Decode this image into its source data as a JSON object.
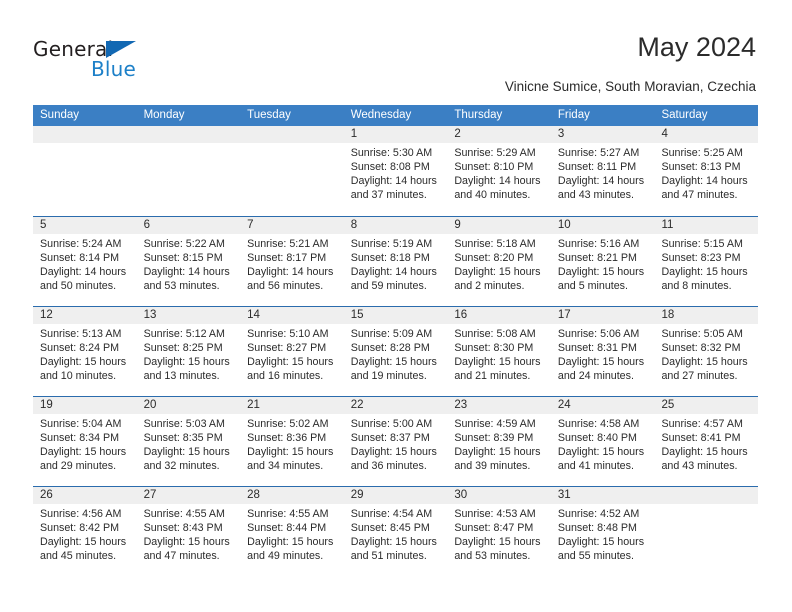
{
  "brand": {
    "name_part1": "General",
    "name_part2": "Blue",
    "triangle_color": "#1268b3",
    "blue_color": "#1d80c8"
  },
  "header": {
    "title": "May 2024",
    "subtitle": "Vinicne Sumice, South Moravian, Czechia"
  },
  "calendar": {
    "header_bg": "#3b7fc4",
    "row_divider": "#2b6cad",
    "daynum_bg": "#efefef",
    "weekdays": [
      "Sunday",
      "Monday",
      "Tuesday",
      "Wednesday",
      "Thursday",
      "Friday",
      "Saturday"
    ],
    "weeks": [
      [
        {
          "day": "",
          "lines": []
        },
        {
          "day": "",
          "lines": []
        },
        {
          "day": "",
          "lines": []
        },
        {
          "day": "1",
          "lines": [
            "Sunrise: 5:30 AM",
            "Sunset: 8:08 PM",
            "Daylight: 14 hours",
            "and 37 minutes."
          ]
        },
        {
          "day": "2",
          "lines": [
            "Sunrise: 5:29 AM",
            "Sunset: 8:10 PM",
            "Daylight: 14 hours",
            "and 40 minutes."
          ]
        },
        {
          "day": "3",
          "lines": [
            "Sunrise: 5:27 AM",
            "Sunset: 8:11 PM",
            "Daylight: 14 hours",
            "and 43 minutes."
          ]
        },
        {
          "day": "4",
          "lines": [
            "Sunrise: 5:25 AM",
            "Sunset: 8:13 PM",
            "Daylight: 14 hours",
            "and 47 minutes."
          ]
        }
      ],
      [
        {
          "day": "5",
          "lines": [
            "Sunrise: 5:24 AM",
            "Sunset: 8:14 PM",
            "Daylight: 14 hours",
            "and 50 minutes."
          ]
        },
        {
          "day": "6",
          "lines": [
            "Sunrise: 5:22 AM",
            "Sunset: 8:15 PM",
            "Daylight: 14 hours",
            "and 53 minutes."
          ]
        },
        {
          "day": "7",
          "lines": [
            "Sunrise: 5:21 AM",
            "Sunset: 8:17 PM",
            "Daylight: 14 hours",
            "and 56 minutes."
          ]
        },
        {
          "day": "8",
          "lines": [
            "Sunrise: 5:19 AM",
            "Sunset: 8:18 PM",
            "Daylight: 14 hours",
            "and 59 minutes."
          ]
        },
        {
          "day": "9",
          "lines": [
            "Sunrise: 5:18 AM",
            "Sunset: 8:20 PM",
            "Daylight: 15 hours",
            "and 2 minutes."
          ]
        },
        {
          "day": "10",
          "lines": [
            "Sunrise: 5:16 AM",
            "Sunset: 8:21 PM",
            "Daylight: 15 hours",
            "and 5 minutes."
          ]
        },
        {
          "day": "11",
          "lines": [
            "Sunrise: 5:15 AM",
            "Sunset: 8:23 PM",
            "Daylight: 15 hours",
            "and 8 minutes."
          ]
        }
      ],
      [
        {
          "day": "12",
          "lines": [
            "Sunrise: 5:13 AM",
            "Sunset: 8:24 PM",
            "Daylight: 15 hours",
            "and 10 minutes."
          ]
        },
        {
          "day": "13",
          "lines": [
            "Sunrise: 5:12 AM",
            "Sunset: 8:25 PM",
            "Daylight: 15 hours",
            "and 13 minutes."
          ]
        },
        {
          "day": "14",
          "lines": [
            "Sunrise: 5:10 AM",
            "Sunset: 8:27 PM",
            "Daylight: 15 hours",
            "and 16 minutes."
          ]
        },
        {
          "day": "15",
          "lines": [
            "Sunrise: 5:09 AM",
            "Sunset: 8:28 PM",
            "Daylight: 15 hours",
            "and 19 minutes."
          ]
        },
        {
          "day": "16",
          "lines": [
            "Sunrise: 5:08 AM",
            "Sunset: 8:30 PM",
            "Daylight: 15 hours",
            "and 21 minutes."
          ]
        },
        {
          "day": "17",
          "lines": [
            "Sunrise: 5:06 AM",
            "Sunset: 8:31 PM",
            "Daylight: 15 hours",
            "and 24 minutes."
          ]
        },
        {
          "day": "18",
          "lines": [
            "Sunrise: 5:05 AM",
            "Sunset: 8:32 PM",
            "Daylight: 15 hours",
            "and 27 minutes."
          ]
        }
      ],
      [
        {
          "day": "19",
          "lines": [
            "Sunrise: 5:04 AM",
            "Sunset: 8:34 PM",
            "Daylight: 15 hours",
            "and 29 minutes."
          ]
        },
        {
          "day": "20",
          "lines": [
            "Sunrise: 5:03 AM",
            "Sunset: 8:35 PM",
            "Daylight: 15 hours",
            "and 32 minutes."
          ]
        },
        {
          "day": "21",
          "lines": [
            "Sunrise: 5:02 AM",
            "Sunset: 8:36 PM",
            "Daylight: 15 hours",
            "and 34 minutes."
          ]
        },
        {
          "day": "22",
          "lines": [
            "Sunrise: 5:00 AM",
            "Sunset: 8:37 PM",
            "Daylight: 15 hours",
            "and 36 minutes."
          ]
        },
        {
          "day": "23",
          "lines": [
            "Sunrise: 4:59 AM",
            "Sunset: 8:39 PM",
            "Daylight: 15 hours",
            "and 39 minutes."
          ]
        },
        {
          "day": "24",
          "lines": [
            "Sunrise: 4:58 AM",
            "Sunset: 8:40 PM",
            "Daylight: 15 hours",
            "and 41 minutes."
          ]
        },
        {
          "day": "25",
          "lines": [
            "Sunrise: 4:57 AM",
            "Sunset: 8:41 PM",
            "Daylight: 15 hours",
            "and 43 minutes."
          ]
        }
      ],
      [
        {
          "day": "26",
          "lines": [
            "Sunrise: 4:56 AM",
            "Sunset: 8:42 PM",
            "Daylight: 15 hours",
            "and 45 minutes."
          ]
        },
        {
          "day": "27",
          "lines": [
            "Sunrise: 4:55 AM",
            "Sunset: 8:43 PM",
            "Daylight: 15 hours",
            "and 47 minutes."
          ]
        },
        {
          "day": "28",
          "lines": [
            "Sunrise: 4:55 AM",
            "Sunset: 8:44 PM",
            "Daylight: 15 hours",
            "and 49 minutes."
          ]
        },
        {
          "day": "29",
          "lines": [
            "Sunrise: 4:54 AM",
            "Sunset: 8:45 PM",
            "Daylight: 15 hours",
            "and 51 minutes."
          ]
        },
        {
          "day": "30",
          "lines": [
            "Sunrise: 4:53 AM",
            "Sunset: 8:47 PM",
            "Daylight: 15 hours",
            "and 53 minutes."
          ]
        },
        {
          "day": "31",
          "lines": [
            "Sunrise: 4:52 AM",
            "Sunset: 8:48 PM",
            "Daylight: 15 hours",
            "and 55 minutes."
          ]
        },
        {
          "day": "",
          "lines": []
        }
      ]
    ]
  }
}
